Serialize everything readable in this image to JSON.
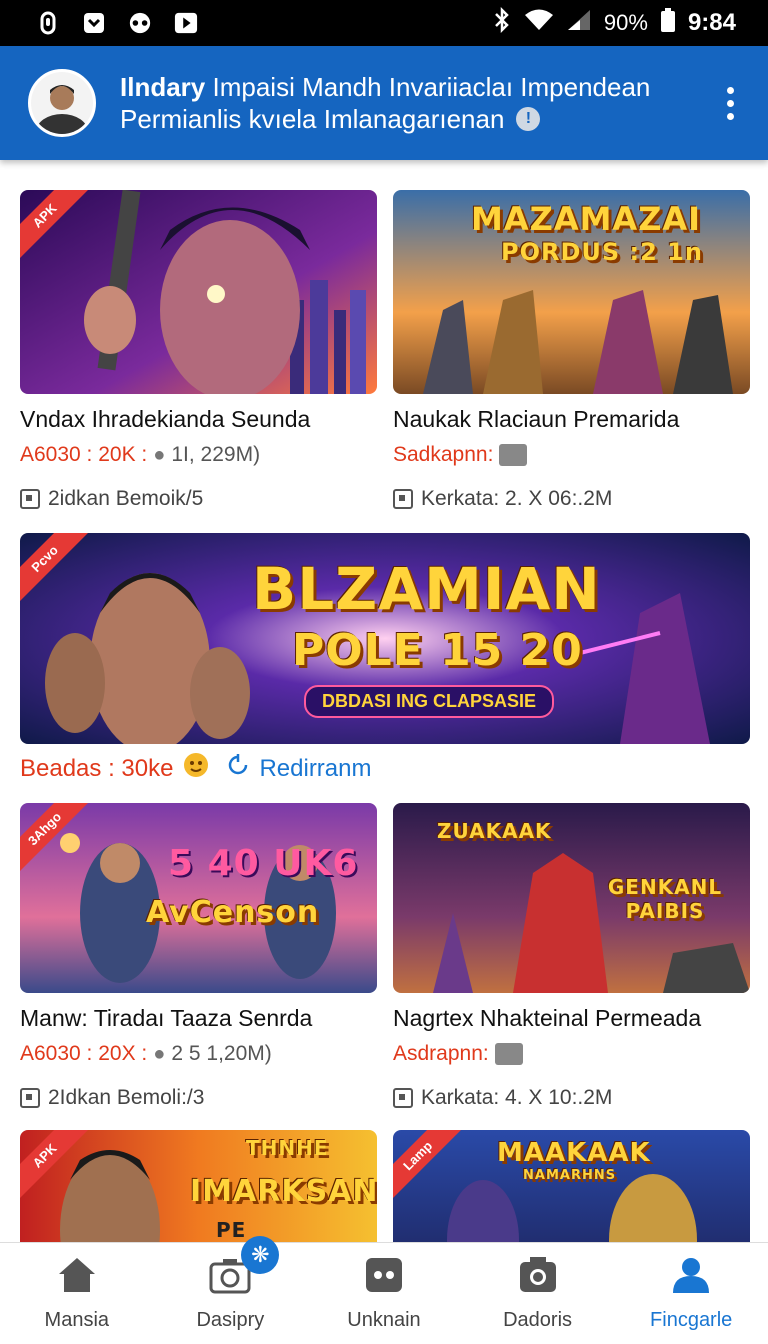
{
  "status_bar": {
    "battery_pct": "90%",
    "time": "9:84",
    "left_icons": [
      "signal-icon",
      "save-icon",
      "messenger-icon",
      "play-icon"
    ],
    "right_icons": [
      "bluetooth-icon",
      "wifi-icon",
      "cell-signal-icon",
      "battery-icon"
    ]
  },
  "header": {
    "line1_bold": "Ilndary",
    "line1_rest": "Impaisi Mandh Invariiaclaı Impendean",
    "line2": "Permianlis kvıela Imlanagarıenan",
    "info_glyph": "!"
  },
  "cards": [
    {
      "title": "Vndax Ihradekianda Seunda",
      "meta_red": "A6030 : 20K :",
      "meta_grey": "1I, 229M)",
      "sub": "2idkan Bemoik/5",
      "ribbon": "APK"
    },
    {
      "title": "Naukak Rlaciaun Premarida",
      "meta_red": "Sadkapnn:",
      "meta_grey": "",
      "sub": "Kerkata: 2. X 06:.2M",
      "banner_title_1": "MAZAMAZAI",
      "banner_title_2": "PORDUS :2 1n"
    },
    {
      "wide": true,
      "banner_title_1": "BLZAMIAN",
      "banner_title_2": "POLE 15 20",
      "banner_pill": "DBDASI ING CLAPSASIE",
      "meta_red": "Beadas : 30ke",
      "meta_blue": "Redirranm",
      "ribbon": "Pcvo"
    },
    {
      "title": "Manw: Tiradaı Taaza Senrda",
      "meta_red": "A6030 : 20X :",
      "meta_grey": "2 5 1,20M)",
      "sub": "2Idkan Bemoli:/3",
      "banner_title_1": "5 40 UK6",
      "banner_title_2": "AvCenson",
      "ribbon": "3Ahgo"
    },
    {
      "title": "Nagrtex Nhakteinal Permeada",
      "meta_red": "Asdrapnn:",
      "meta_grey": "",
      "sub": "Karkata: 4. X 10:.2M",
      "banner_title_1": "ZUAKAAK",
      "banner_title_2": "GENKANL PAIBIS"
    },
    {
      "banner_title_1": "THNHE",
      "banner_title_2": "IMARKSANN",
      "banner_title_3": "PE FICLCAAIT",
      "ribbon": "APK"
    },
    {
      "banner_title_1": "MAAKAAK",
      "banner_title_2": "NAMARHNS",
      "ribbon": "Lamp"
    }
  ],
  "bottom_nav": [
    {
      "label": "Mansia",
      "icon": "home-icon"
    },
    {
      "label": "Dasipry",
      "icon": "camera-icon"
    },
    {
      "label": "Unknain",
      "icon": "game-controller-icon"
    },
    {
      "label": "Dadoris",
      "icon": "photo-icon"
    },
    {
      "label": "Fincgarle",
      "icon": "profile-icon",
      "active": true
    }
  ],
  "colors": {
    "header": "#1565c0",
    "accent": "#1976d2",
    "price_red": "#e0391b"
  }
}
